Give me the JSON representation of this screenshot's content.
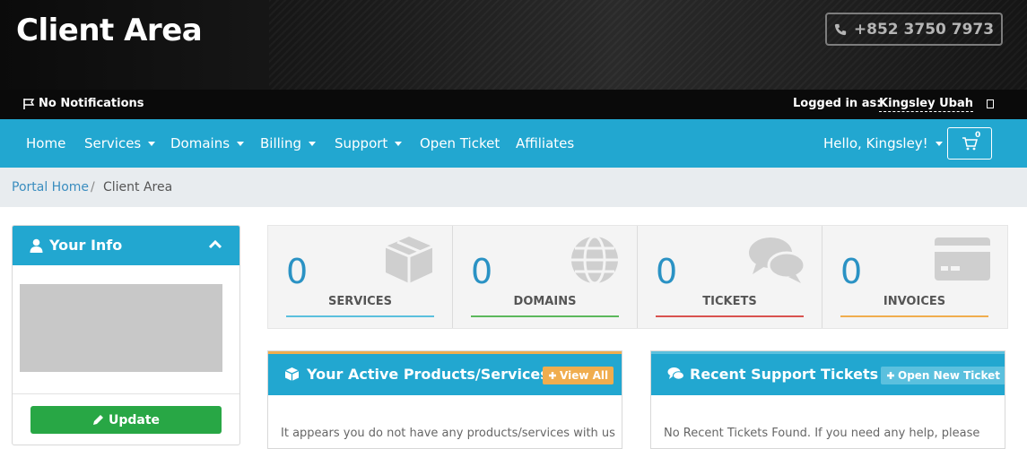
{
  "header": {
    "title": "Client Area",
    "phone": "+852 3750 7973"
  },
  "topbar": {
    "notifications": "No Notifications",
    "logged_in_label": "Logged in as:",
    "username": "Kingsley Ubah"
  },
  "nav": {
    "items": [
      {
        "label": "Home"
      },
      {
        "label": "Services"
      },
      {
        "label": "Domains"
      },
      {
        "label": "Billing"
      },
      {
        "label": "Support"
      },
      {
        "label": "Open Ticket"
      },
      {
        "label": "Affiliates"
      }
    ],
    "greeting": "Hello, Kingsley!",
    "cart_count": "0"
  },
  "breadcrumb": {
    "home": "Portal Home",
    "separator": "/",
    "current": "Client Area"
  },
  "info_panel": {
    "title": "Your Info",
    "update_label": "Update"
  },
  "stats": [
    {
      "value": "0",
      "label": "SERVICES",
      "color": "#5bc0de"
    },
    {
      "value": "0",
      "label": "DOMAINS",
      "color": "#5cb85c"
    },
    {
      "value": "0",
      "label": "TICKETS",
      "color": "#d9534f"
    },
    {
      "value": "0",
      "label": "INVOICES",
      "color": "#f0ad4e"
    }
  ],
  "products_panel": {
    "title": "Your Active Products/Services",
    "button": "View All",
    "body": "It appears you do not have any products/services with us",
    "accent": "#f0ad4e"
  },
  "tickets_panel": {
    "title": "Recent Support Tickets",
    "button": "Open New Ticket",
    "body": "No Recent Tickets Found. If you need any help, please",
    "accent": "#5bc0de"
  },
  "colors": {
    "brand": "#22a7d0",
    "success": "#28a745",
    "header_bg": "#111111"
  }
}
